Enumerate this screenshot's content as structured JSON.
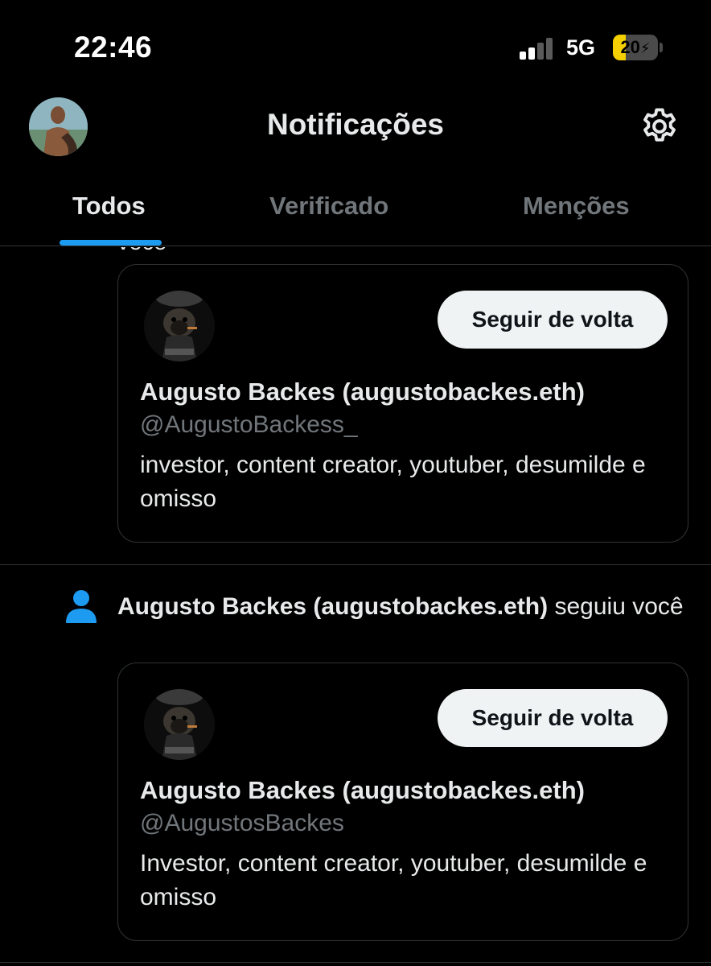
{
  "status_bar": {
    "time": "22:46",
    "network": "5G",
    "battery": "20",
    "battery_charging": true,
    "signal_bars_active": 2,
    "signal_bars_total": 4
  },
  "header": {
    "title": "Notificações",
    "avatar_icon": "profile-avatar",
    "settings_icon": "gear-icon"
  },
  "tabs": [
    {
      "label": "Todos",
      "active": true
    },
    {
      "label": "Verificado",
      "active": false
    },
    {
      "label": "Menções",
      "active": false
    }
  ],
  "feed": {
    "cut_off_text": "você",
    "notifications": [
      {
        "card": {
          "button_label": "Seguir de volta",
          "name": "Augusto Backes (augustobackes.eth)",
          "handle": "@AugustoBackess_",
          "bio": "investor, content creator, youtuber, desumilde e omisso"
        }
      },
      {
        "icon": "person-icon",
        "actor": "Augusto Backes (augustobackes.eth)",
        "action": "seguiu você",
        "card": {
          "button_label": "Seguir de volta",
          "name": "Augusto Backes (augustobackes.eth)",
          "handle": "@AugustosBackes",
          "bio": "Investor, content creator, youtuber, desumilde e omisso"
        }
      }
    ]
  },
  "colors": {
    "background": "#000000",
    "accent": "#1d9bf0",
    "secondary_text": "#71767b",
    "border": "#2f3336",
    "button_bg": "#eff3f4"
  }
}
